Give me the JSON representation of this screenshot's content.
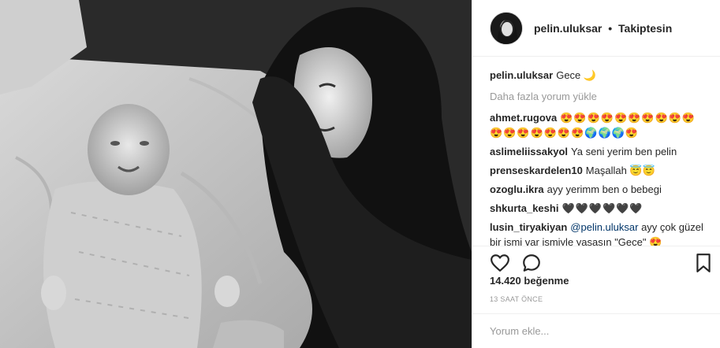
{
  "post": {
    "username": "pelin.uluksar",
    "separator": "•",
    "follow_status": "Takiptesin"
  },
  "caption": {
    "user": "pelin.uluksar",
    "text": "Gece 🌙"
  },
  "load_more_label": "Daha fazla yorum yükle",
  "comments": [
    {
      "user": "ahmet.rugova",
      "text": "😍😍😍😍😍😍😍😍😍😍😍😍😍😍😍😍😍🌍🌍🌍😍"
    },
    {
      "user": "aslimeliissakyol",
      "text": "Ya seni yerim ben pelin"
    },
    {
      "user": "prenseskardelen10",
      "text": "Maşallah 😇😇"
    },
    {
      "user": "ozoglu.ikra",
      "text": "ayy yerimm ben o bebegi"
    },
    {
      "user": "shkurta_keshi",
      "text": "🖤🖤🖤🖤🖤🖤"
    },
    {
      "user": "lusin_tiryakiyan",
      "mention": "@pelin.uluksar",
      "text": " ayy çok güzel bir ismi var ismiyle yaşasın \"Gece\" 😍"
    }
  ],
  "likes_text": "14.420 beğenme",
  "timestamp": "13 SAAT ÖNCE",
  "comment_input": {
    "placeholder": "Yorum ekle...",
    "value": ""
  },
  "icons": {
    "like": "heart-outline-icon",
    "comment": "speech-bubble-icon",
    "save": "bookmark-icon"
  }
}
